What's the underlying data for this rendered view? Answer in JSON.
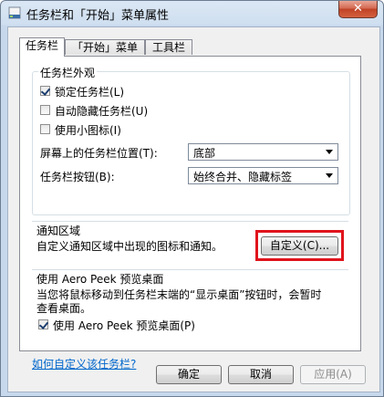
{
  "window": {
    "title": "任务栏和「开始」菜单属性",
    "close_glyph": "✕"
  },
  "tabs": [
    {
      "label": "任务栏"
    },
    {
      "label": "「开始」菜单"
    },
    {
      "label": "工具栏"
    }
  ],
  "appearance": {
    "legend": "任务栏外观",
    "checkboxes": [
      {
        "label": "锁定任务栏(L)",
        "checked": true
      },
      {
        "label": "自动隐藏任务栏(U)",
        "checked": false
      },
      {
        "label": "使用小图标(I)",
        "checked": false
      }
    ],
    "position_label": "屏幕上的任务栏位置(T):",
    "position_value": "底部",
    "buttons_label": "任务栏按钮(B):",
    "buttons_value": "始终合并、隐藏标签"
  },
  "notification": {
    "legend": "通知区域",
    "description": "自定义通知区域中出现的图标和通知。",
    "customize_button": "自定义(C)..."
  },
  "aero_peek": {
    "legend": "使用 Aero Peek 预览桌面",
    "description_line1": "当您将鼠标移动到任务栏末端的“显示桌面”按钮时，会暂时",
    "description_line2": "查看桌面。",
    "checkbox_label": "使用 Aero Peek 预览桌面(P)",
    "checked": true
  },
  "help_link": "如何自定义该任务栏?",
  "footer": {
    "ok": "确定",
    "cancel": "取消",
    "apply": "应用(A)"
  },
  "colors": {
    "highlight": "#e0131c",
    "link": "#0066cc",
    "close_button": "#c04226"
  }
}
